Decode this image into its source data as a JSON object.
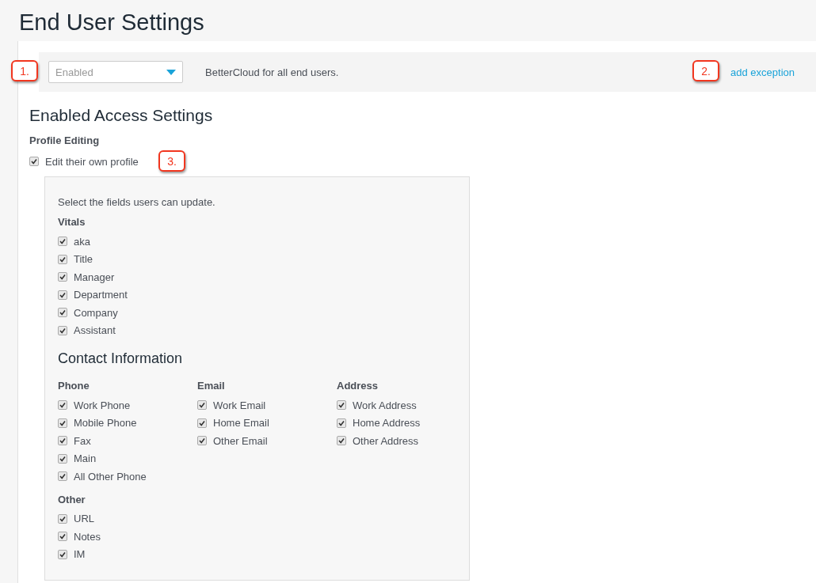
{
  "page_title": "End User Settings",
  "access_bar": {
    "select": {
      "value": "Enabled"
    },
    "description": "BetterCloud for all end users.",
    "link": "add exception"
  },
  "section_title": "Enabled Access Settings",
  "profile_editing": {
    "label": "Profile Editing",
    "option": {
      "label": "Edit their own profile",
      "checked": true
    }
  },
  "fields_panel": {
    "intro": "Select the fields users can update.",
    "vitals": {
      "label": "Vitals",
      "items": [
        {
          "label": "aka",
          "checked": true
        },
        {
          "label": "Title",
          "checked": true
        },
        {
          "label": "Manager",
          "checked": true
        },
        {
          "label": "Department",
          "checked": true
        },
        {
          "label": "Company",
          "checked": true
        },
        {
          "label": "Assistant",
          "checked": true
        }
      ]
    },
    "contact_title": "Contact Information",
    "groups": [
      {
        "label": "Phone",
        "items": [
          {
            "label": "Work Phone",
            "checked": true
          },
          {
            "label": "Mobile Phone",
            "checked": true
          },
          {
            "label": "Fax",
            "checked": true
          },
          {
            "label": "Main",
            "checked": true
          },
          {
            "label": "All Other Phone",
            "checked": true
          }
        ]
      },
      {
        "label": "Email",
        "items": [
          {
            "label": "Work Email",
            "checked": true
          },
          {
            "label": "Home Email",
            "checked": true
          },
          {
            "label": "Other Email",
            "checked": true
          }
        ]
      },
      {
        "label": "Address",
        "items": [
          {
            "label": "Work Address",
            "checked": true
          },
          {
            "label": "Home Address",
            "checked": true
          },
          {
            "label": "Other Address",
            "checked": true
          }
        ]
      },
      {
        "label": "Other",
        "items": [
          {
            "label": "URL",
            "checked": true
          },
          {
            "label": "Notes",
            "checked": true
          },
          {
            "label": "IM",
            "checked": true
          }
        ]
      }
    ]
  },
  "callouts": [
    "1.",
    "2.",
    "3."
  ]
}
